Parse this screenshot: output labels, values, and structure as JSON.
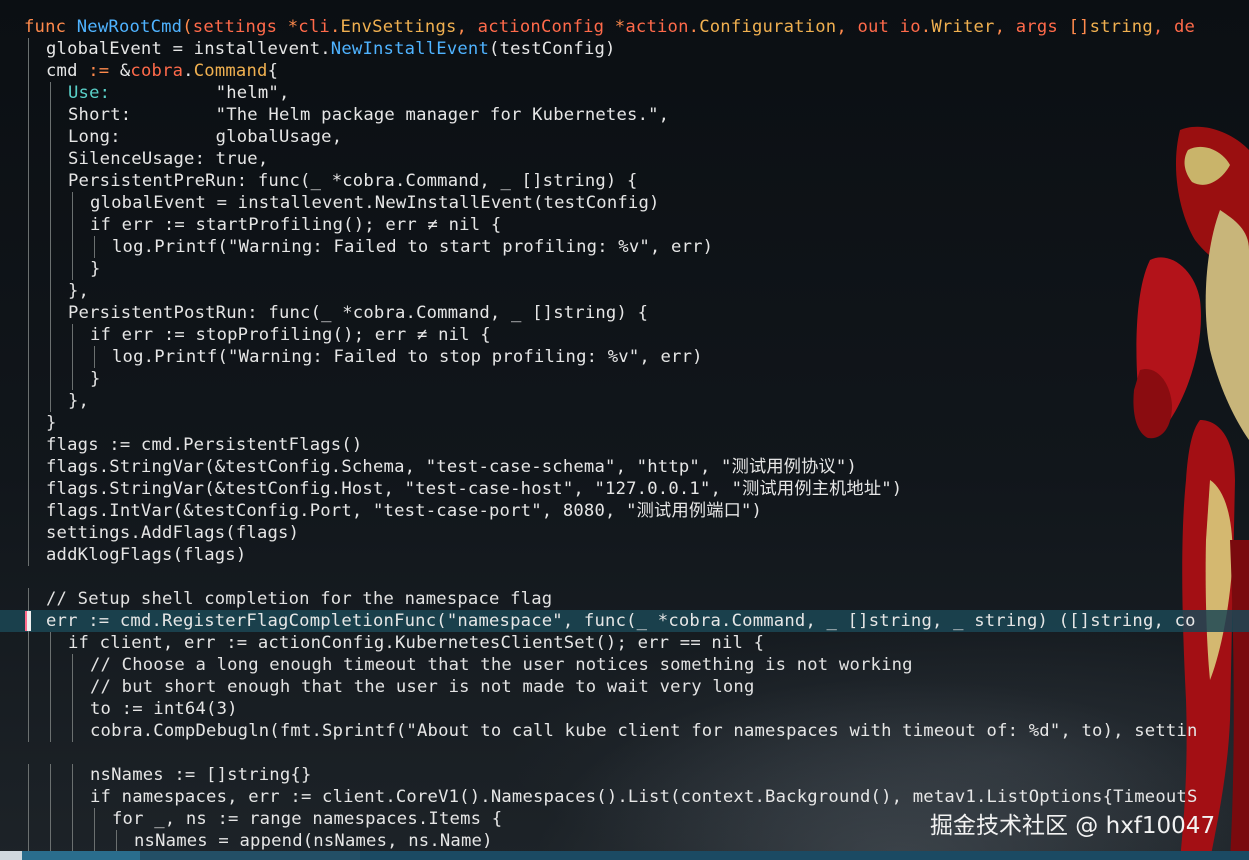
{
  "editor": {
    "lines": [
      {
        "indent": 0,
        "current": false,
        "tokens": [
          {
            "t": "func ",
            "c": "keyword"
          },
          {
            "t": "NewRootCmd",
            "c": "func"
          },
          {
            "t": "(",
            "c": "keyword"
          },
          {
            "t": "settings ",
            "c": "param"
          },
          {
            "t": "*",
            "c": "keyword"
          },
          {
            "t": "cli",
            "c": "param"
          },
          {
            "t": ".",
            "c": "keyword"
          },
          {
            "t": "EnvSettings",
            "c": "type"
          },
          {
            "t": ", ",
            "c": "keyword"
          },
          {
            "t": "actionConfig ",
            "c": "param"
          },
          {
            "t": "*",
            "c": "keyword"
          },
          {
            "t": "action",
            "c": "param"
          },
          {
            "t": ".",
            "c": "keyword"
          },
          {
            "t": "Configuration",
            "c": "type"
          },
          {
            "t": ", ",
            "c": "keyword"
          },
          {
            "t": "out ",
            "c": "param"
          },
          {
            "t": "io",
            "c": "param"
          },
          {
            "t": ".",
            "c": "keyword"
          },
          {
            "t": "Writer",
            "c": "type"
          },
          {
            "t": ", ",
            "c": "keyword"
          },
          {
            "t": "args ",
            "c": "param"
          },
          {
            "t": "[]",
            "c": "keyword"
          },
          {
            "t": "string",
            "c": "type"
          },
          {
            "t": ", de",
            "c": "param"
          }
        ]
      },
      {
        "indent": 1,
        "current": false,
        "tokens": [
          {
            "t": "globalEvent = installevent.",
            "c": "plain"
          },
          {
            "t": "NewInstallEvent",
            "c": "func"
          },
          {
            "t": "(testConfig)",
            "c": "plain"
          }
        ]
      },
      {
        "indent": 1,
        "current": false,
        "tokens": [
          {
            "t": "cmd ",
            "c": "plain"
          },
          {
            "t": ":=",
            "c": "op"
          },
          {
            "t": " &",
            "c": "plain"
          },
          {
            "t": "cobra",
            "c": "param"
          },
          {
            "t": ".",
            "c": "plain"
          },
          {
            "t": "Command",
            "c": "type"
          },
          {
            "t": "{",
            "c": "plain"
          }
        ]
      },
      {
        "indent": 2,
        "current": false,
        "tokens": [
          {
            "t": "Use:",
            "c": "field"
          },
          {
            "t": "          ",
            "c": "plain"
          },
          {
            "t": "\"helm\"",
            "c": "string"
          },
          {
            "t": ",",
            "c": "plain"
          }
        ]
      },
      {
        "indent": 2,
        "current": false,
        "tokens": [
          {
            "t": "Short:        \"The Helm package manager for Kubernetes.\",",
            "c": "plain"
          }
        ]
      },
      {
        "indent": 2,
        "current": false,
        "tokens": [
          {
            "t": "Long:         globalUsage,",
            "c": "plain"
          }
        ]
      },
      {
        "indent": 2,
        "current": false,
        "tokens": [
          {
            "t": "SilenceUsage: true,",
            "c": "plain"
          }
        ]
      },
      {
        "indent": 2,
        "current": false,
        "tokens": [
          {
            "t": "PersistentPreRun: func(_ *cobra.Command, _ []string) {",
            "c": "plain"
          }
        ]
      },
      {
        "indent": 3,
        "current": false,
        "tokens": [
          {
            "t": "globalEvent = installevent.NewInstallEvent(testConfig)",
            "c": "plain"
          }
        ]
      },
      {
        "indent": 3,
        "current": false,
        "tokens": [
          {
            "t": "if err := startProfiling(); err ≠ nil {",
            "c": "plain"
          }
        ]
      },
      {
        "indent": 4,
        "current": false,
        "tokens": [
          {
            "t": "log.Printf(\"Warning: Failed to start profiling: %v\", err)",
            "c": "plain"
          }
        ]
      },
      {
        "indent": 3,
        "current": false,
        "tokens": [
          {
            "t": "}",
            "c": "plain"
          }
        ]
      },
      {
        "indent": 2,
        "current": false,
        "tokens": [
          {
            "t": "},",
            "c": "plain"
          }
        ]
      },
      {
        "indent": 2,
        "current": false,
        "tokens": [
          {
            "t": "PersistentPostRun: func(_ *cobra.Command, _ []string) {",
            "c": "plain"
          }
        ]
      },
      {
        "indent": 3,
        "current": false,
        "tokens": [
          {
            "t": "if err := stopProfiling(); err ≠ nil {",
            "c": "plain"
          }
        ]
      },
      {
        "indent": 4,
        "current": false,
        "tokens": [
          {
            "t": "log.Printf(\"Warning: Failed to stop profiling: %v\", err)",
            "c": "plain"
          }
        ]
      },
      {
        "indent": 3,
        "current": false,
        "tokens": [
          {
            "t": "}",
            "c": "plain"
          }
        ]
      },
      {
        "indent": 2,
        "current": false,
        "tokens": [
          {
            "t": "},",
            "c": "plain"
          }
        ]
      },
      {
        "indent": 1,
        "current": false,
        "tokens": [
          {
            "t": "}",
            "c": "plain"
          }
        ]
      },
      {
        "indent": 1,
        "current": false,
        "tokens": [
          {
            "t": "flags := cmd.PersistentFlags()",
            "c": "plain"
          }
        ]
      },
      {
        "indent": 1,
        "current": false,
        "tokens": [
          {
            "t": "flags.StringVar(&testConfig.Schema, \"test-case-schema\", \"http\", \"测试用例协议\")",
            "c": "plain"
          }
        ]
      },
      {
        "indent": 1,
        "current": false,
        "tokens": [
          {
            "t": "flags.StringVar(&testConfig.Host, \"test-case-host\", \"127.0.0.1\", \"测试用例主机地址\")",
            "c": "plain"
          }
        ]
      },
      {
        "indent": 1,
        "current": false,
        "tokens": [
          {
            "t": "flags.IntVar(&testConfig.Port, \"test-case-port\", 8080, \"测试用例端口\")",
            "c": "plain"
          }
        ]
      },
      {
        "indent": 1,
        "current": false,
        "tokens": [
          {
            "t": "settings.AddFlags(flags)",
            "c": "plain"
          }
        ]
      },
      {
        "indent": 1,
        "current": false,
        "tokens": [
          {
            "t": "addKlogFlags(flags)",
            "c": "plain"
          }
        ]
      },
      {
        "indent": 0,
        "current": false,
        "tokens": []
      },
      {
        "indent": 1,
        "current": false,
        "tokens": [
          {
            "t": "// Setup shell completion for the namespace flag",
            "c": "comment"
          }
        ]
      },
      {
        "indent": 1,
        "current": true,
        "tokens": [
          {
            "t": "err := cmd.RegisterFlagCompletionFunc(\"namespace\", func(_ *cobra.Command, _ []string, _ string) ([]string, co",
            "c": "plain"
          }
        ]
      },
      {
        "indent": 2,
        "current": false,
        "tokens": [
          {
            "t": "if client, err := actionConfig.KubernetesClientSet(); err == nil {",
            "c": "plain"
          }
        ]
      },
      {
        "indent": 3,
        "current": false,
        "tokens": [
          {
            "t": "// Choose a long enough timeout that the user notices something is not working",
            "c": "comment"
          }
        ]
      },
      {
        "indent": 3,
        "current": false,
        "tokens": [
          {
            "t": "// but short enough that the user is not made to wait very long",
            "c": "comment"
          }
        ]
      },
      {
        "indent": 3,
        "current": false,
        "tokens": [
          {
            "t": "to := int64(3)",
            "c": "plain"
          }
        ]
      },
      {
        "indent": 3,
        "current": false,
        "tokens": [
          {
            "t": "cobra.CompDebugln(fmt.Sprintf(\"About to call kube client for namespaces with timeout of: %d\", to), settin",
            "c": "plain"
          }
        ]
      },
      {
        "indent": 0,
        "current": false,
        "tokens": []
      },
      {
        "indent": 3,
        "current": false,
        "tokens": [
          {
            "t": "nsNames := []string{}",
            "c": "plain"
          }
        ]
      },
      {
        "indent": 3,
        "current": false,
        "tokens": [
          {
            "t": "if namespaces, err := client.CoreV1().Namespaces().List(context.Background(), metav1.ListOptions{TimeoutS",
            "c": "plain"
          }
        ]
      },
      {
        "indent": 4,
        "current": false,
        "tokens": [
          {
            "t": "for _, ns := range namespaces.Items {",
            "c": "plain"
          }
        ]
      },
      {
        "indent": 5,
        "current": false,
        "tokens": [
          {
            "t": "nsNames = append(nsNames, ns.Name)",
            "c": "plain"
          }
        ]
      }
    ]
  },
  "watermark": "掘金技术社区 @ hxf10047",
  "colors": {
    "background": "#101418",
    "current_line": "#1b4655",
    "keyword": "#ff8a4c",
    "function": "#4fb3ff",
    "parameter": "#ff6a4a",
    "type": "#f0b050",
    "field": "#5ad0c8",
    "statusbar": "#1b4a63"
  }
}
